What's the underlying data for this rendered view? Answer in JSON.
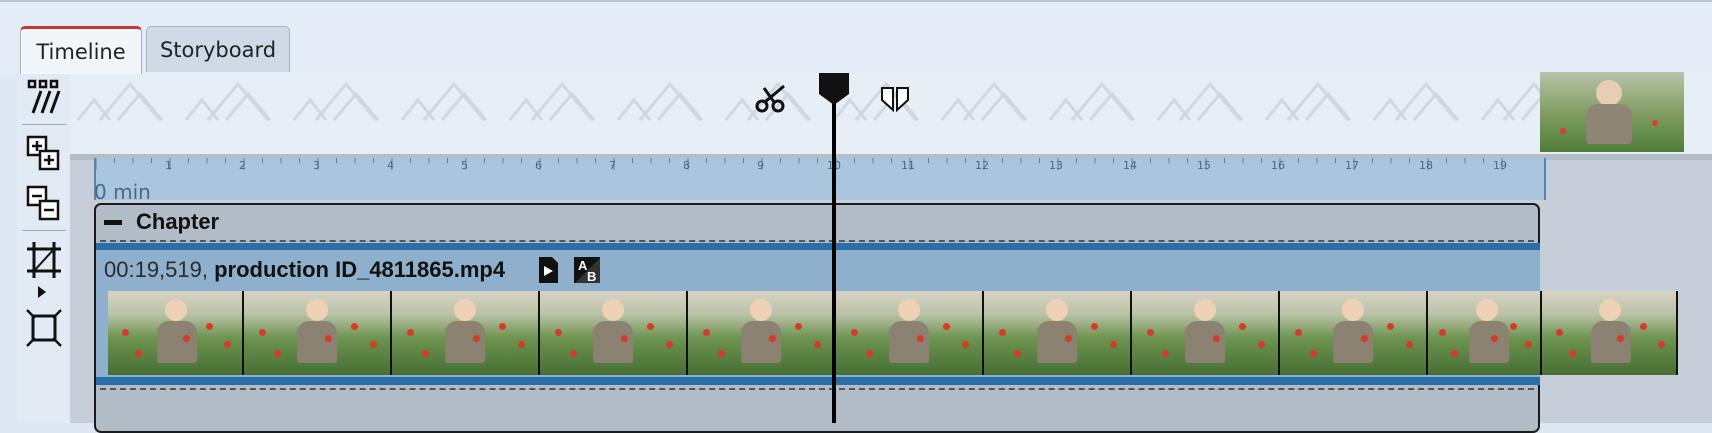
{
  "tabs": [
    {
      "label": "Timeline",
      "active": true
    },
    {
      "label": "Storyboard",
      "active": false
    }
  ],
  "toolbar": {
    "tools": [
      "multi-track-icon",
      "add-track-icon",
      "remove-track-icon",
      "crop-frame-icon",
      "fit-frame-icon"
    ]
  },
  "ruler": {
    "unit_label": "0 min",
    "ticks": [
      "1",
      "2",
      "3",
      "4",
      "5",
      "6",
      "7",
      "8",
      "9",
      "10",
      "11",
      "12",
      "13",
      "14",
      "15",
      "16",
      "17",
      "18",
      "19"
    ]
  },
  "chapter": {
    "label": "Chapter",
    "collapse_icon": "minus-icon"
  },
  "clip": {
    "duration": "00:19,519,",
    "filename": "production ID_4811865.mp4",
    "icons": [
      "video-file-icon",
      "transition-ab-icon"
    ]
  },
  "colors": {
    "active_tab_accent": "#c43a32",
    "clip_border": "#2a6fa8",
    "clip_bg": "#8fb0cc",
    "ruler_bg": "#a9c6de"
  },
  "markers": [
    "scissors-icon",
    "playhead-marker-icon",
    "split-marker-icon"
  ]
}
